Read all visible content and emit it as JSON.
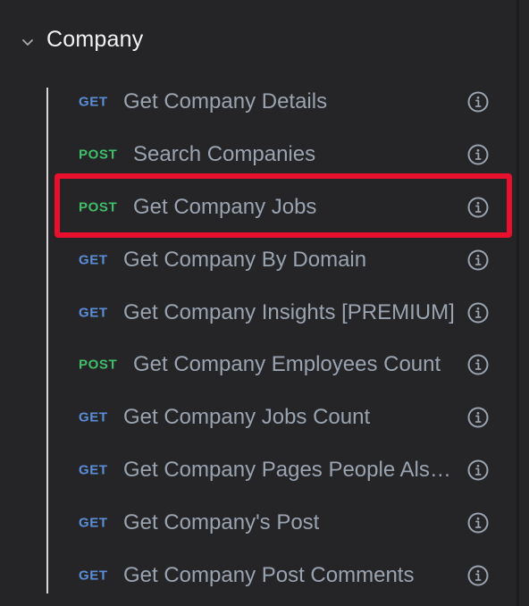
{
  "group": {
    "title": "Company",
    "expanded_icon": "chevron-down-icon"
  },
  "endpoints": [
    {
      "method": "GET",
      "label": "Get Company Details"
    },
    {
      "method": "POST",
      "label": "Search Companies"
    },
    {
      "method": "POST",
      "label": "Get Company Jobs",
      "highlighted": true
    },
    {
      "method": "GET",
      "label": "Get Company By Domain"
    },
    {
      "method": "GET",
      "label": "Get Company Insights [PREMIUM]"
    },
    {
      "method": "POST",
      "label": "Get Company Employees Count"
    },
    {
      "method": "GET",
      "label": "Get Company Jobs Count"
    },
    {
      "method": "GET",
      "label": "Get Company Pages People Also Viewed"
    },
    {
      "method": "GET",
      "label": "Get Company's Post"
    },
    {
      "method": "GET",
      "label": "Get Company Post Comments"
    }
  ],
  "colors": {
    "background": "#252528",
    "get": "#5b8ed8",
    "post": "#3fbf6a",
    "label": "#9aa3b0",
    "highlight": "#e8102d"
  },
  "icons": {
    "info": "info-circle-icon"
  }
}
